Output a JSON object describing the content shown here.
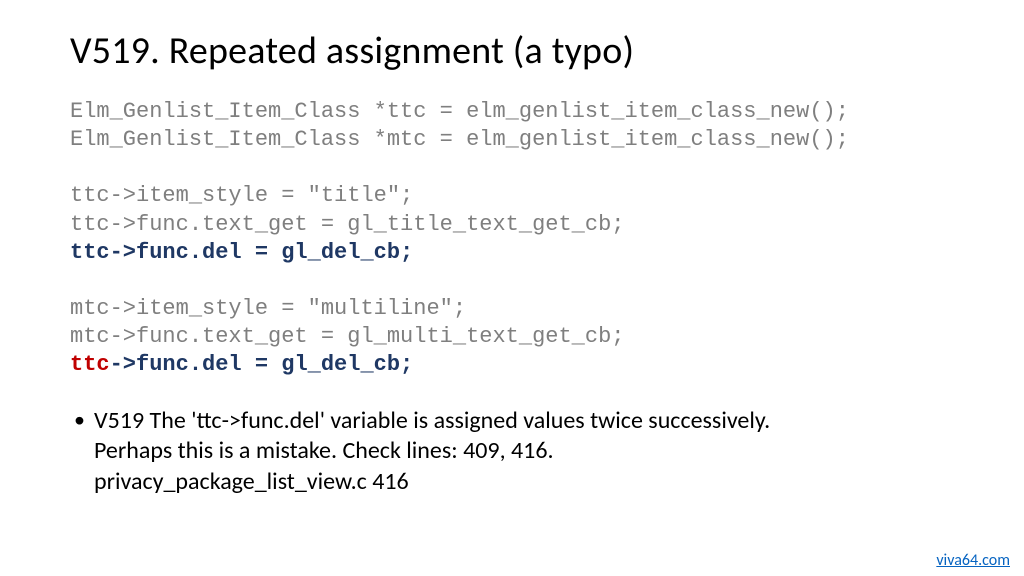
{
  "title": "V519. Repeated assignment (a typo)",
  "code": {
    "l1": "Elm_Genlist_Item_Class *ttc = elm_genlist_item_class_new();",
    "l2": "Elm_Genlist_Item_Class *mtc = elm_genlist_item_class_new();",
    "l3": "ttc->item_style = \"title\";",
    "l4": "ttc->func.text_get = gl_title_text_get_cb;",
    "l5": "ttc->func.del = gl_del_cb;",
    "l6": "mtc->item_style = \"multiline\";",
    "l7": "mtc->func.text_get = gl_multi_text_get_cb;",
    "l8_typo": "ttc",
    "l8_rest": "->func.del = gl_del_cb;"
  },
  "bullet": {
    "line1": "V519 The 'ttc->func.del' variable is assigned values twice successively.",
    "line2": "Perhaps this is a mistake. Check lines: 409, 416.",
    "line3": "privacy_package_list_view.c 416"
  },
  "footer_link": "viva64.com"
}
